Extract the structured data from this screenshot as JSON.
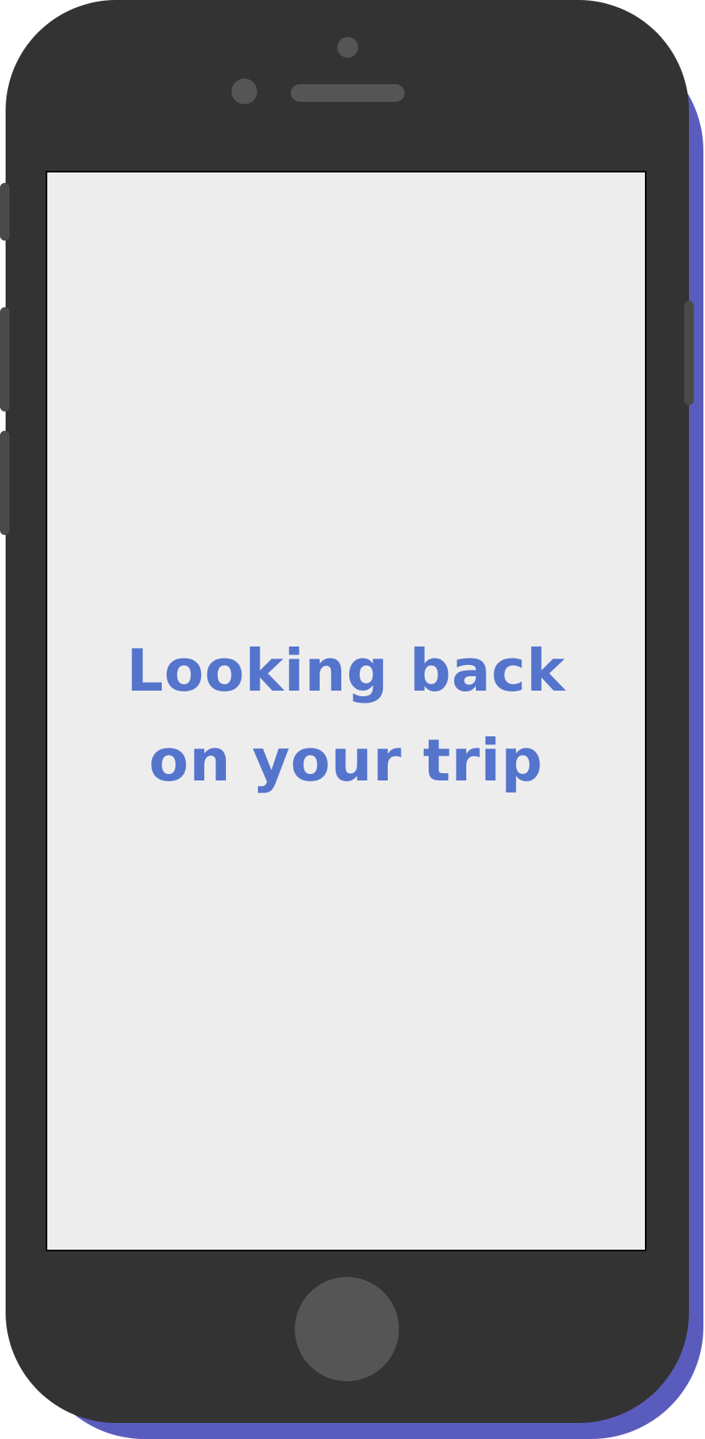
{
  "screen": {
    "headline_line1": "Looking back",
    "headline_line2": "on your trip"
  },
  "colors": {
    "accent": "#5574cc",
    "phone_body": "#333333",
    "phone_shadow": "#5a5cbd",
    "screen_background": "#ededee"
  }
}
